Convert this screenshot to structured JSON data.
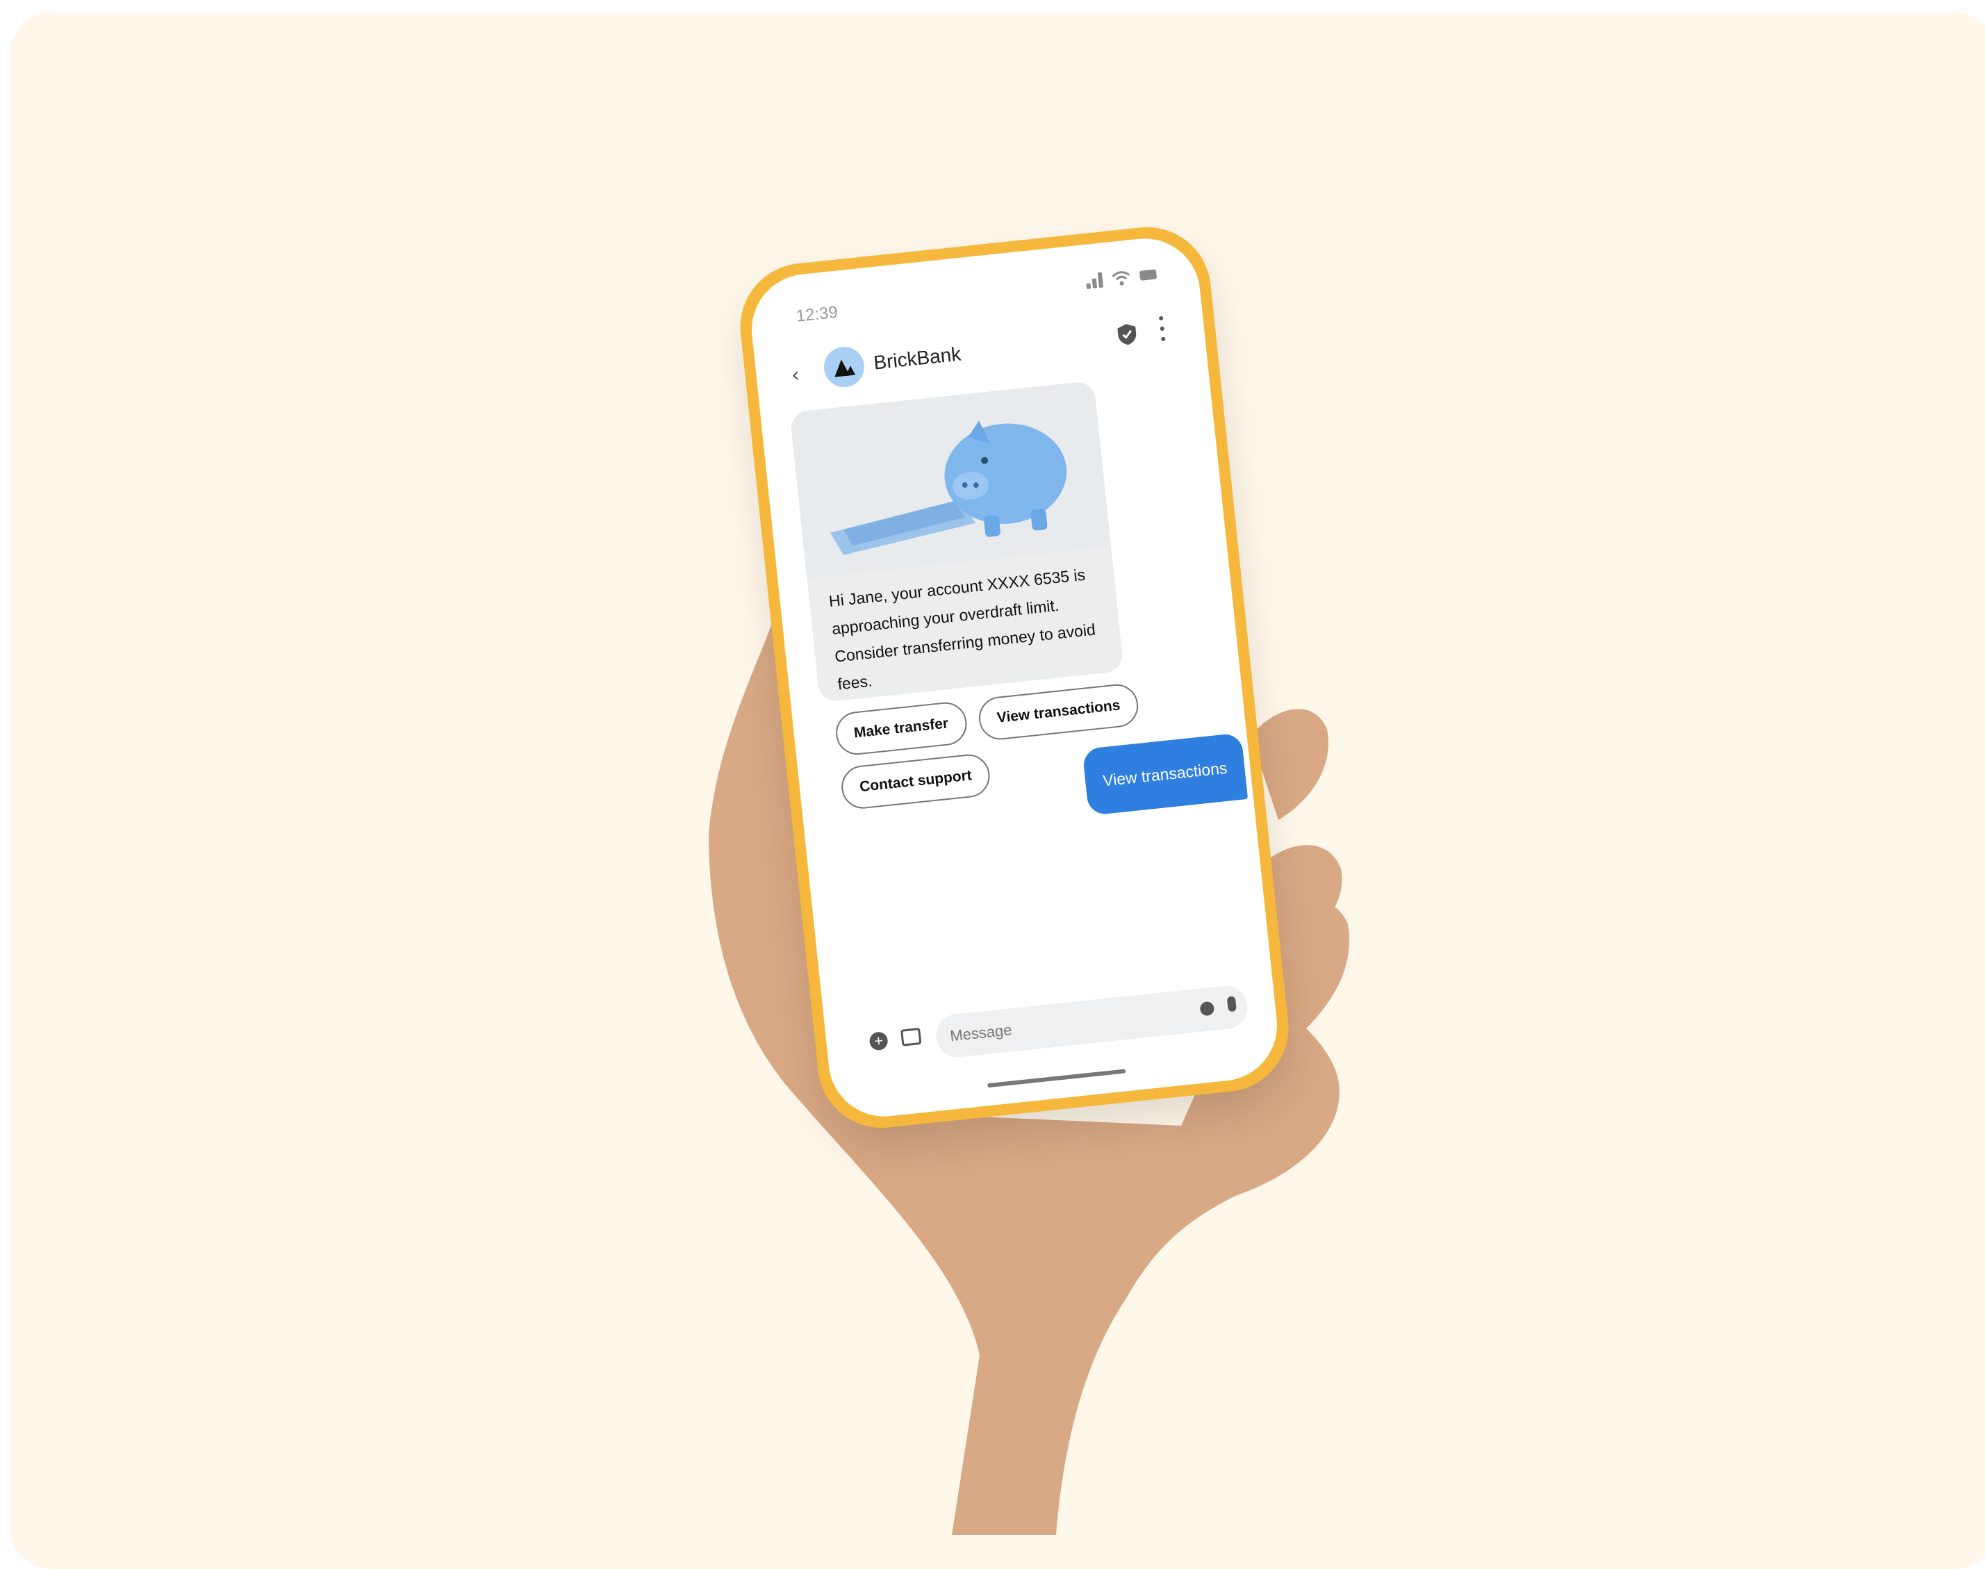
{
  "status_bar": {
    "time": "12:39"
  },
  "header": {
    "back_icon": "chevron-left-icon",
    "brand_name": "BrickBank"
  },
  "rich_card": {
    "image": "piggy-bank-calculator-image",
    "text": "Hi Jane, your account XXXX 6535 is approaching your overdraft limit. Consider transferring money to avoid fees."
  },
  "suggestions": [
    "Make transfer",
    "View transactions",
    "Contact support"
  ],
  "sent_message": "View transactions",
  "compose": {
    "placeholder": "Message"
  },
  "colors": {
    "phone_frame": "#f6b83c",
    "sent_bubble": "#2f7fe0",
    "avatar": "#a9cff5",
    "backdrop": "#fff8ea"
  }
}
